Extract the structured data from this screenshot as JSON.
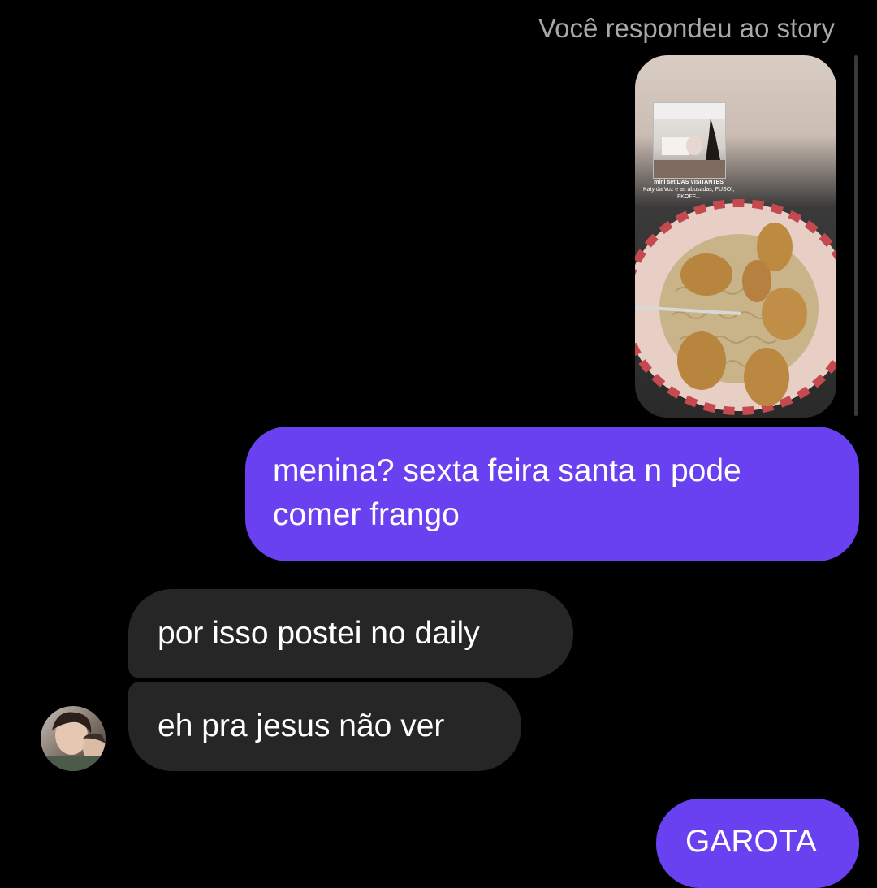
{
  "story_reply": {
    "caption": "Você respondeu ao story",
    "mini_post": {
      "title": "mini set DAS VISITANTES",
      "subtitle": "Katy da Voz e as abusadas, FUSO!, FKOFF..."
    }
  },
  "messages": [
    {
      "direction": "outgoing",
      "text": "menina? sexta feira santa n pode comer frango"
    },
    {
      "direction": "incoming",
      "text": "por isso postei no daily"
    },
    {
      "direction": "incoming",
      "text": "eh pra jesus não ver"
    },
    {
      "direction": "outgoing",
      "text": "GAROTA"
    }
  ],
  "colors": {
    "background": "#000000",
    "outgoing_bubble": "#6a41f0",
    "incoming_bubble": "#262626",
    "caption_text": "#a8a8a8"
  },
  "icons": {
    "avatar": "contact-profile-photo"
  }
}
